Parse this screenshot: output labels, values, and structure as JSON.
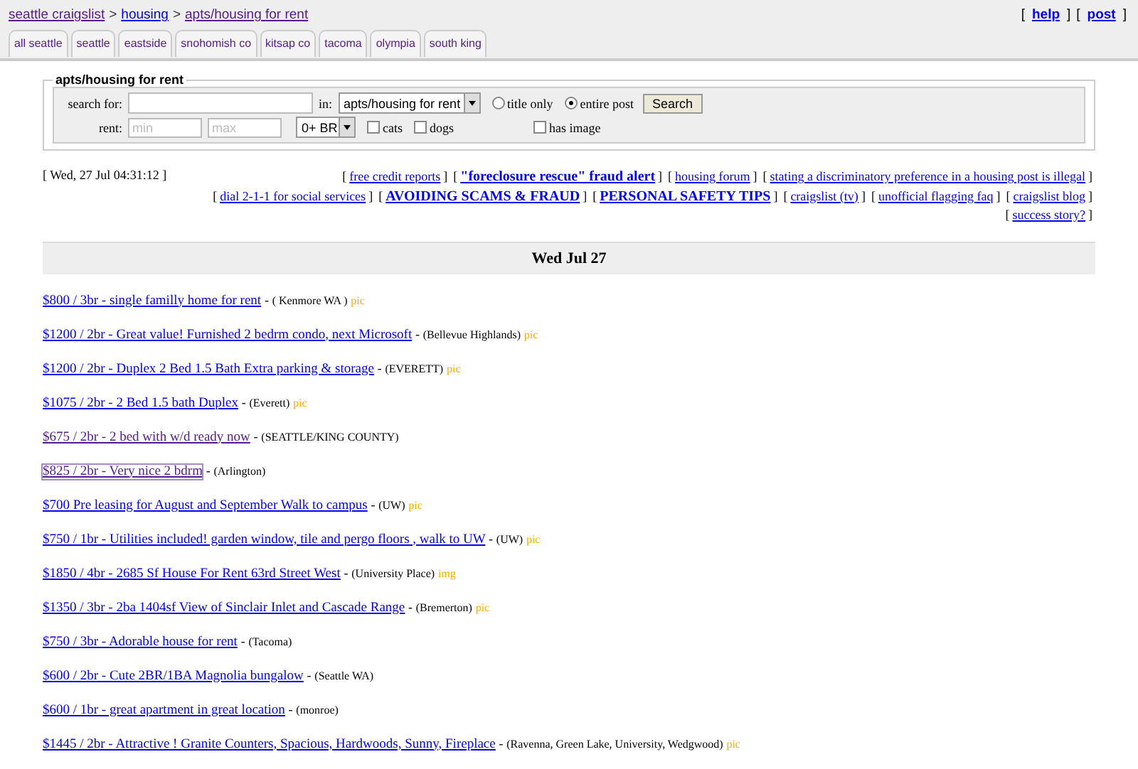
{
  "breadcrumb": [
    {
      "text": "seattle craigslist",
      "visited": true,
      "sep": ">"
    },
    {
      "text": "housing",
      "visited": false,
      "sep": ">"
    },
    {
      "text": "apts/housing for rent",
      "visited": true
    }
  ],
  "top_links": [
    {
      "open": "[",
      "text": "help",
      "close": "]"
    },
    {
      "open": "[",
      "text": "post",
      "close": "]"
    }
  ],
  "tabs": [
    "all seattle",
    "seattle",
    "eastside",
    "snohomish co",
    "kitsap co",
    "tacoma",
    "olympia",
    "south king"
  ],
  "search_form": {
    "legend": "apts/housing for rent",
    "search_label": "search for:",
    "in_label": "in:",
    "category": "apts/housing for rent",
    "radios": [
      {
        "label": "title only",
        "selected": false
      },
      {
        "label": "entire post",
        "selected": true
      }
    ],
    "button": "Search",
    "rent_label": "rent:",
    "min_placeholder": "min",
    "max_placeholder": "max",
    "bedrooms": "0+ BR",
    "checkboxes": [
      {
        "label": "cats",
        "checked": false
      },
      {
        "label": "dogs",
        "checked": false
      },
      {
        "label": "has image",
        "checked": false
      }
    ]
  },
  "timestamp": "[ Wed, 27 Jul 04:31:12 ]",
  "info_links": [
    [
      {
        "open": "[",
        "text": "free credit reports",
        "close": "]",
        "bold": false
      },
      {
        "open": "[",
        "text": "\"foreclosure rescue\" fraud alert",
        "close": "]",
        "bold": true
      },
      {
        "open": "[",
        "text": "housing forum",
        "close": "]",
        "bold": false
      },
      {
        "open": "[",
        "text": "stating a discriminatory preference in a housing post is illegal",
        "close": "]",
        "bold": false
      }
    ],
    [
      {
        "open": "[",
        "text": "dial 2-1-1 for social services",
        "close": "]",
        "bold": false
      },
      {
        "open": "[",
        "text": "AVOIDING SCAMS & FRAUD",
        "close": "]",
        "bold": true
      },
      {
        "open": "[",
        "text": "PERSONAL SAFETY TIPS",
        "close": "]",
        "bold": true
      },
      {
        "open": "[",
        "text": "craigslist (tv)",
        "close": "]",
        "bold": false
      },
      {
        "open": "[",
        "text": "unofficial flagging faq",
        "close": "]",
        "bold": false
      },
      {
        "open": "[",
        "text": "craigslist blog",
        "close": "]",
        "bold": false
      }
    ],
    [
      {
        "open": "[",
        "text": "success story?",
        "close": "]",
        "bold": false
      }
    ]
  ],
  "date_header": "Wed Jul 27",
  "listings": [
    {
      "title": "$800 / 3br - single familly home for rent",
      "sep": "-",
      "location": "( Kenmore WA )",
      "tag": "pic",
      "visited": false,
      "focused": false
    },
    {
      "title": "$1200 / 2br - Great value! Furnished 2 bedrm condo, next Microsoft",
      "sep": "-",
      "location": "(Bellevue Highlands)",
      "tag": "pic",
      "visited": false,
      "focused": false
    },
    {
      "title": "$1200 / 2br - Duplex 2 Bed 1.5 Bath Extra parking & storage",
      "sep": "-",
      "location": "(EVERETT)",
      "tag": "pic",
      "visited": false,
      "focused": false
    },
    {
      "title": "$1075 / 2br - 2 Bed 1.5 bath Duplex",
      "sep": "-",
      "location": "(Everett)",
      "tag": "pic",
      "visited": false,
      "focused": false
    },
    {
      "title": "$675 / 2br - 2 bed with w/d ready now",
      "sep": "-",
      "location": "(SEATTLE/KING COUNTY)",
      "visited": true,
      "focused": false
    },
    {
      "title": "$825 / 2br - Very nice 2 bdrm",
      "sep": "-",
      "location": "(Arlington)",
      "visited": true,
      "focused": true
    },
    {
      "title": "$700 Pre leasing for August and September Walk to campus",
      "sep": "-",
      "location": "(UW)",
      "tag": "pic",
      "visited": false,
      "focused": false
    },
    {
      "title": "$750 / 1br - Utilities included! garden window, tile and pergo floors , walk to UW",
      "sep": "-",
      "location": "(UW)",
      "tag": "pic",
      "visited": false,
      "focused": false
    },
    {
      "title": "$1850 / 4br - 2685 Sf House For Rent 63rd Street West",
      "sep": "-",
      "location": "(University Place)",
      "tag": "img",
      "visited": false,
      "focused": false
    },
    {
      "title": "$1350 / 3br - 2ba 1404sf View of Sinclair Inlet and Cascade Range",
      "sep": "-",
      "location": "(Bremerton)",
      "tag": "pic",
      "visited": false,
      "focused": false
    },
    {
      "title": "$750 / 3br - Adorable house for rent",
      "sep": "-",
      "location": "(Tacoma)",
      "visited": false,
      "focused": false
    },
    {
      "title": "$600 / 2br - Cute 2BR/1BA Magnolia bungalow",
      "sep": "-",
      "location": "(Seattle WA)",
      "visited": false,
      "focused": false
    },
    {
      "title": "$600 / 1br - great apartment in great location",
      "sep": "-",
      "location": "(monroe)",
      "visited": false,
      "focused": false
    },
    {
      "title": "$1445 / 2br - Attractive ! Granite Counters, Spacious, Hardwoods, Sunny, Fireplace",
      "sep": "-",
      "location": "(Ravenna, Green Lake, University, Wedgwood)",
      "tag": "pic",
      "visited": false,
      "focused": false
    }
  ]
}
